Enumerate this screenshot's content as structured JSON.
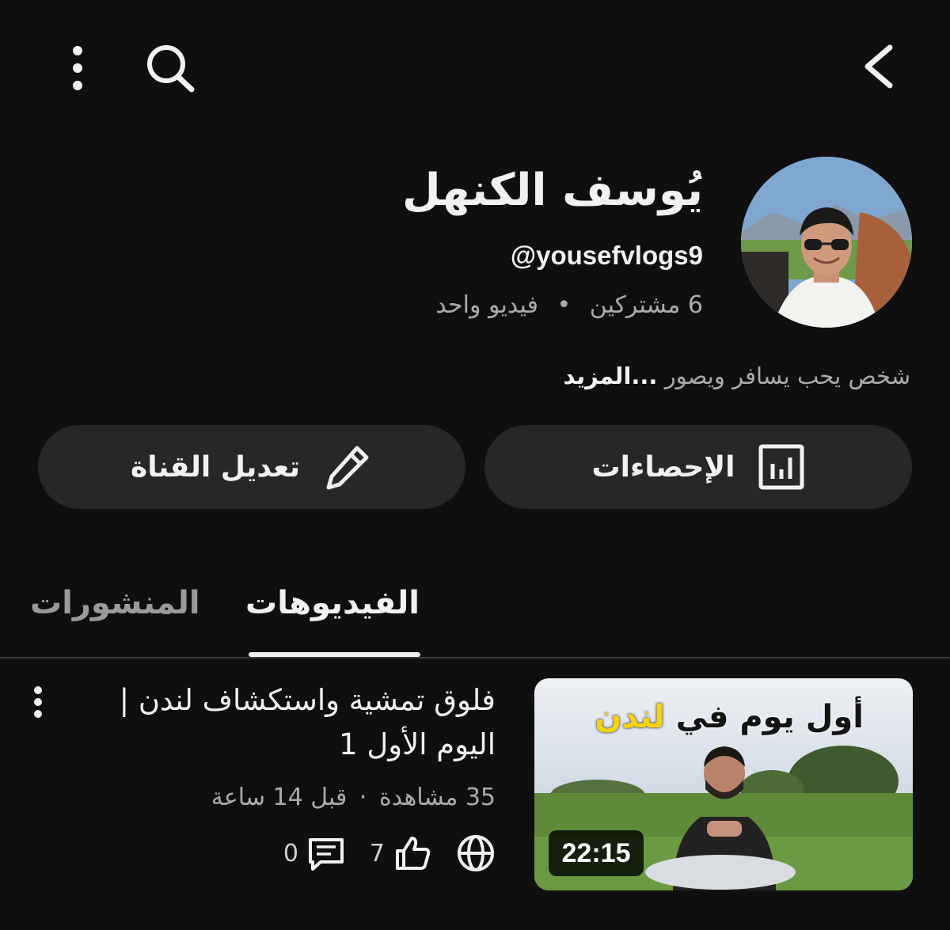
{
  "header": {
    "back_icon": "chevron-left-icon",
    "search_icon": "search-icon",
    "more_icon": "more-vert-icon"
  },
  "channel": {
    "name": "يُوسف الكنهل",
    "handle": "@yousefvlogs9",
    "subscribers": "6 مشتركين",
    "separator": "•",
    "videos_count": "فيديو واحد",
    "description": "شخص يحب يسافر ويصور",
    "more_label": "...المزيد"
  },
  "actions": {
    "stats_label": "الإحصاءات",
    "stats_icon": "analytics-icon",
    "edit_label": "تعديل القناة",
    "edit_icon": "pencil-icon"
  },
  "tabs": [
    {
      "label": "الفيديوهات",
      "active": true
    },
    {
      "label": "المنشورات",
      "active": false
    }
  ],
  "video": {
    "thumbnail_text_1": "أول يوم في",
    "thumbnail_text_2": "لندن",
    "duration": "22:15",
    "title": "فلوق تمشية واستكشاف لندن | اليوم الأول 1",
    "views": "35 مشاهدة",
    "meta_separator": "·",
    "age": "قبل 14 ساعة",
    "visibility_icon": "globe-icon",
    "likes": "7",
    "like_icon": "thumbs-up-icon",
    "comments": "0",
    "comment_icon": "comment-icon"
  },
  "colors": {
    "background": "#0f0f0f",
    "surface": "#272727",
    "text": "#f1f1f1",
    "secondary_text": "#aaaaaa",
    "thumbnail_accent": "#f5d312"
  }
}
